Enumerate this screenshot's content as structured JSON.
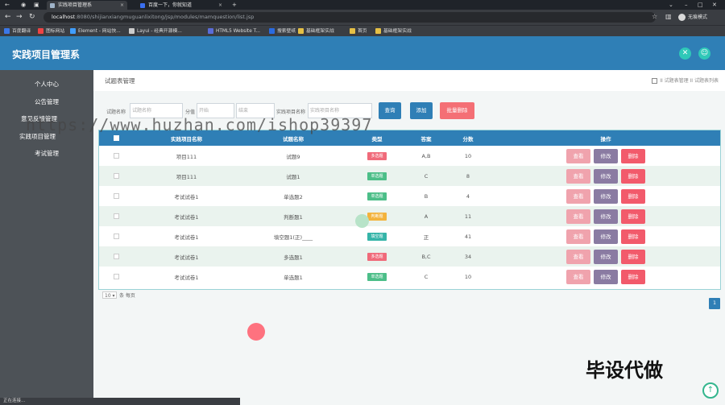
{
  "browser": {
    "tabs": [
      {
        "title": "实践项目管理系"
      },
      {
        "title": "百度一下，你就知道"
      }
    ],
    "url_host": "localhost",
    "url_path": ":8080/shijianxiangmuguanlixitong/jsp/modules/mamquestion/list.jsp",
    "profile_label": "无痕模式",
    "bookmarks": [
      "百度翻译",
      "图标网站",
      "Element - 网站快...",
      "Layui - 经典开源模...",
      "HTML5 Website T...",
      "搜索壁纸",
      "基础框架实战",
      "首页",
      "基础框架实战"
    ],
    "status_text": "正在连接..."
  },
  "app": {
    "title": "实践项目管理系"
  },
  "sidebar": {
    "items": [
      {
        "label": "个人中心"
      },
      {
        "label": "公告管理"
      },
      {
        "label": "意见反馈管理"
      },
      {
        "label": "实践项目管理"
      },
      {
        "label": "考试管理"
      }
    ]
  },
  "page": {
    "title": "试题表管理",
    "breadcrumb": "II 试题表管理 II 试题表列表"
  },
  "search": {
    "label1": "试题名称",
    "placeholder1": "试题名称",
    "label2": "分值",
    "placeholder2": "开始",
    "placeholder3": "结束",
    "label3": "实践项目名称",
    "placeholder4": "实践项目名称",
    "query_label": "查询",
    "add_label": "添加",
    "batch_delete_label": "批量删除"
  },
  "table": {
    "headers": [
      "实践项目名称",
      "试题名称",
      "类型",
      "答案",
      "分数",
      "操作"
    ],
    "rows": [
      {
        "project": "项目111",
        "question": "试题9",
        "type": "多选题",
        "answer": "A,B",
        "score": "10"
      },
      {
        "project": "项目111",
        "question": "试题1",
        "type": "单选题",
        "answer": "C",
        "score": "8"
      },
      {
        "project": "考试试卷1",
        "question": "单选题2",
        "type": "单选题",
        "answer": "B",
        "score": "4"
      },
      {
        "project": "考试试卷1",
        "question": "判断题1",
        "type": "判断题",
        "answer": "A",
        "score": "11"
      },
      {
        "project": "考试试卷1",
        "question": "填空题1(正)____",
        "type": "填空题",
        "answer": "正",
        "score": "41"
      },
      {
        "project": "考试试卷1",
        "question": "多选题1",
        "type": "多选题",
        "answer": "B,C",
        "score": "34"
      },
      {
        "project": "考试试卷1",
        "question": "单选题1",
        "type": "单选题",
        "answer": "C",
        "score": "10"
      }
    ],
    "view_label": "查看",
    "edit_label": "修改",
    "delete_label": "删除"
  },
  "pager": {
    "page_size": "10",
    "per_page_label": "条 每页",
    "current_page": "1"
  },
  "overlays": {
    "watermark": "https://www.huzhan.com/ishop39397",
    "corner_text": "毕设代做"
  },
  "colors": {
    "header_blue": "#2f7fb6",
    "sidebar_gray": "#4d5257",
    "type_multi": "#f06a7a",
    "type_single": "#4cbe88",
    "type_judge": "#f3b33d",
    "type_fill": "#35b4a8",
    "btn_view": "#f0a3ad",
    "btn_edit": "#8a7ba2",
    "btn_delete": "#f25a6b",
    "btn_query": "#2f7fb6",
    "btn_batch_delete": "#f46f75"
  }
}
